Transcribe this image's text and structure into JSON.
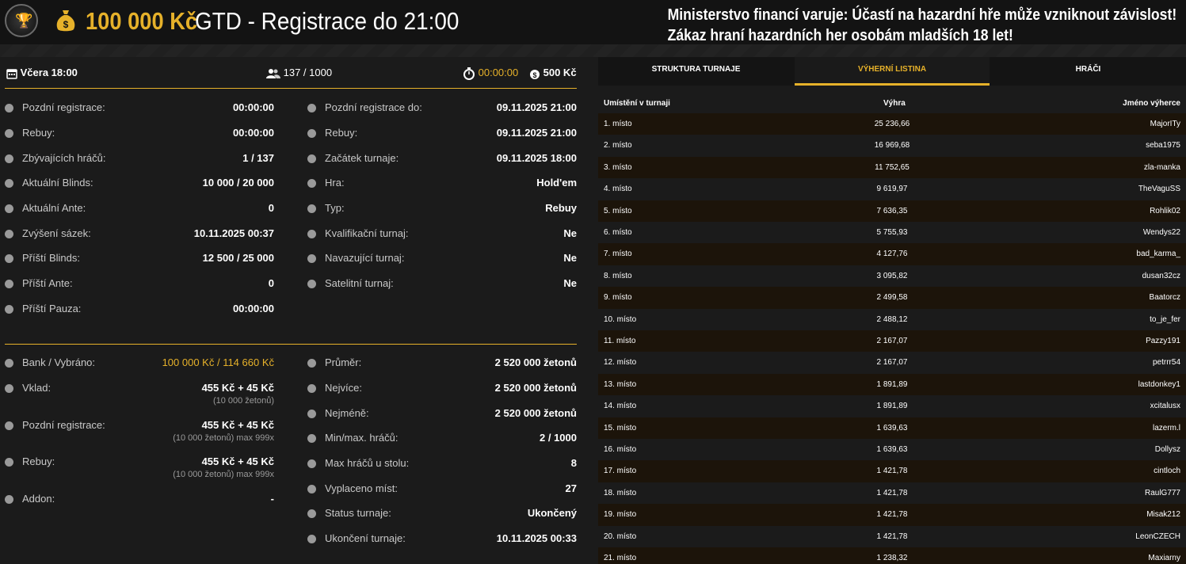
{
  "header": {
    "logo_icon": "trophy-chip-logo",
    "bag_icon": "money-bag-icon",
    "amount": "100 000 Kč",
    "title": "GTD - Registrace do 21:00",
    "warning_line1": "Ministerstvo financí varuje: Účastí na hazardní hře může vzniknout závislost!",
    "warning_line2": "Zákaz hraní hazardních her osobám mladších 18 let!"
  },
  "summary": {
    "date": "Včera 18:00",
    "players": "137 / 1000",
    "timer": "00:00:00",
    "fee": "500 Kč"
  },
  "left_col": [
    {
      "label": "Pozdní registrace:",
      "value": "00:00:00"
    },
    {
      "label": "Rebuy:",
      "value": "00:00:00"
    },
    {
      "label": "Zbývajících hráčů:",
      "value": "1 / 137"
    },
    {
      "label": "Aktuální Blinds:",
      "value": "10 000 / 20 000"
    },
    {
      "label": "Aktuální Ante:",
      "value": "0"
    },
    {
      "label": "Zvýšení sázek:",
      "value": "10.11.2025 00:37"
    },
    {
      "label": "Příští Blinds:",
      "value": "12 500 / 25 000"
    },
    {
      "label": "Příští Ante:",
      "value": "0"
    },
    {
      "label": "Příští Pauza:",
      "value": "00:00:00"
    }
  ],
  "right_col": [
    {
      "label": "Pozdní registrace do:",
      "value": "09.11.2025 21:00"
    },
    {
      "label": "Rebuy:",
      "value": "09.11.2025 21:00"
    },
    {
      "label": "Začátek turnaje:",
      "value": "09.11.2025 18:00"
    },
    {
      "label": "Hra:",
      "value": "Hold'em"
    },
    {
      "label": "Typ:",
      "value": "Rebuy"
    },
    {
      "label": "Kvalifikační turnaj:",
      "value": "Ne"
    },
    {
      "label": "Navazující turnaj:",
      "value": "Ne"
    },
    {
      "label": "Satelitní turnaj:",
      "value": "Ne"
    }
  ],
  "bottom_left": [
    {
      "label": "Bank / Vybráno:",
      "value": "100 000 Kč / 114 660 Kč",
      "sub": ""
    },
    {
      "label": "Vklad:",
      "value": "455 Kč + 45 Kč",
      "sub": "(10 000 žetonů)"
    },
    {
      "label": "Pozdní registrace:",
      "value": "455 Kč + 45 Kč",
      "sub": "(10 000 žetonů) max 999x"
    },
    {
      "label": "Rebuy:",
      "value": "455 Kč + 45 Kč",
      "sub": "(10 000 žetonů) max 999x"
    },
    {
      "label": "Addon:",
      "value": "-",
      "sub": ""
    }
  ],
  "bottom_right": [
    {
      "label": "Průměr:",
      "value": "2 520 000 žetonů"
    },
    {
      "label": "Nejvíce:",
      "value": "2 520 000 žetonů"
    },
    {
      "label": "Nejméně:",
      "value": "2 520 000 žetonů"
    },
    {
      "label": "Min/max. hráčů:",
      "value": "2 / 1000"
    },
    {
      "label": "Max hráčů u stolu:",
      "value": "8"
    },
    {
      "label": "Vyplaceno míst:",
      "value": "27"
    },
    {
      "label": "Status turnaje:",
      "value": "Ukončený"
    },
    {
      "label": "Ukončení turnaje:",
      "value": "10.11.2025 00:33"
    }
  ],
  "tabs": [
    "STRUKTURA TURNAJE",
    "VÝHERNÍ LISTINA",
    "HRÁČI"
  ],
  "table": {
    "headers": [
      "Umístění v turnaji",
      "Výhra",
      "Jméno výherce"
    ],
    "rows": [
      [
        "1. místo",
        "25 236,66",
        "MajorITy"
      ],
      [
        "2. místo",
        "16 969,68",
        "seba1975"
      ],
      [
        "3. místo",
        "11 752,65",
        "zla-manka"
      ],
      [
        "4. místo",
        "9 619,97",
        "TheVaguSS"
      ],
      [
        "5. místo",
        "7 636,35",
        "Rohlik02"
      ],
      [
        "6. místo",
        "5 755,93",
        "Wendys22"
      ],
      [
        "7. místo",
        "4 127,76",
        "bad_karma_"
      ],
      [
        "8. místo",
        "3 095,82",
        "dusan32cz"
      ],
      [
        "9. místo",
        "2 499,58",
        "Baatorcz"
      ],
      [
        "10. místo",
        "2 488,12",
        "to_je_fer"
      ],
      [
        "11. místo",
        "2 167,07",
        "Pazzy191"
      ],
      [
        "12. místo",
        "2 167,07",
        "petrrr54"
      ],
      [
        "13. místo",
        "1 891,89",
        "lastdonkey1"
      ],
      [
        "14. místo",
        "1 891,89",
        "xcitalusx"
      ],
      [
        "15. místo",
        "1 639,63",
        "lazerm.l"
      ],
      [
        "16. místo",
        "1 639,63",
        "Dollysz"
      ],
      [
        "17. místo",
        "1 421,78",
        "cintloch"
      ],
      [
        "18. místo",
        "1 421,78",
        "RaulG777"
      ],
      [
        "19. místo",
        "1 421,78",
        "Misak212"
      ],
      [
        "20. místo",
        "1 421,78",
        "LeonCZECH"
      ],
      [
        "21. místo",
        "1 238,32",
        "Maxiarny"
      ]
    ]
  },
  "colors": {
    "accent": "#e6b12a",
    "bg": "#1b1b1b",
    "row_alt": "#1c140a"
  }
}
